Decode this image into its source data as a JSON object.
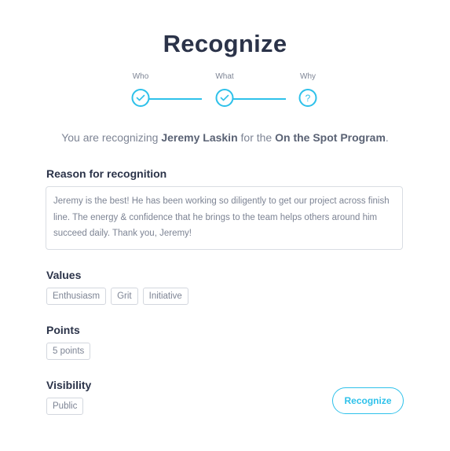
{
  "page": {
    "title": "Recognize"
  },
  "stepper": {
    "steps": [
      {
        "label": "Who",
        "status": "complete",
        "icon": "check-icon"
      },
      {
        "label": "What",
        "status": "complete",
        "icon": "check-icon"
      },
      {
        "label": "Why",
        "status": "current",
        "icon": "question-icon",
        "glyph": "?"
      }
    ],
    "accent_color": "#2ec1ea"
  },
  "summary": {
    "prefix": "You are recognizing ",
    "recipient": "Jeremy Laskin",
    "middle": " for the ",
    "program": "On the Spot Program",
    "suffix": "."
  },
  "reason": {
    "label": "Reason for recognition",
    "text": "Jeremy is the best! He has been working so diligently to get our project across finish line. The energy & confidence that he brings to the team helps others around him succeed daily. Thank you, Jeremy!"
  },
  "values": {
    "label": "Values",
    "items": [
      "Enthusiasm",
      "Grit",
      "Initiative"
    ]
  },
  "points": {
    "label": "Points",
    "value": "5 points"
  },
  "visibility": {
    "label": "Visibility",
    "value": "Public"
  },
  "actions": {
    "submit_label": "Recognize"
  }
}
